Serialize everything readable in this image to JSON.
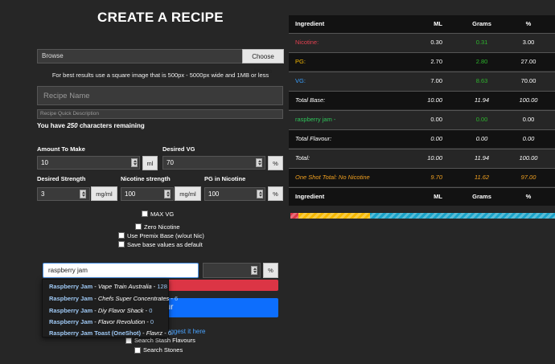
{
  "page": {
    "title": "CREATE A RECIPE"
  },
  "image_upload": {
    "browse_label": "Browse",
    "choose_button": "Choose Image",
    "hint": "For best results use a square image that is 500px - 5000px wide and 1MB or less"
  },
  "recipe": {
    "name_placeholder": "Recipe Name",
    "description_placeholder": "Recipe Quick Description",
    "chars_prefix": "You have",
    "chars_count": "250",
    "chars_suffix": "characters remaining"
  },
  "form": {
    "amount_label": "Amount To Make",
    "amount_value": "10",
    "amount_unit": "ml",
    "desired_vg_label": "Desired VG",
    "desired_vg_value": "70",
    "desired_vg_unit": "%",
    "desired_strength_label": "Desired Strength",
    "desired_strength_value": "3",
    "desired_strength_unit": "mg/ml",
    "nicotine_strength_label": "Nicotine strength",
    "nicotine_strength_value": "100",
    "nicotine_strength_unit": "mg/ml",
    "pg_nicotine_label": "PG in Nicotine",
    "pg_nicotine_value": "100",
    "pg_nicotine_unit": "%"
  },
  "options": {
    "max_vg": "MAX VG",
    "zero_nicotine": "Zero Nicotine",
    "premix": "Use Premix Base (w/out Nic)",
    "save_defaults": "Save base values as default"
  },
  "flavour_search": {
    "value": "raspberry jam",
    "qty_unit": "%",
    "add_button_fragment": "our",
    "suggest_fragment": "uggest it here",
    "search_stash": "Search Stash Flavours",
    "search_stones": "Search Stones",
    "results": [
      {
        "name": "Raspberry Jam",
        "maker": "Vape Train Australia",
        "count": "128"
      },
      {
        "name": "Raspberry Jam",
        "maker": "Chefs Super Concentrates",
        "count": "6"
      },
      {
        "name": "Raspberry Jam",
        "maker": "Diy Flavor Shack",
        "count": "0"
      },
      {
        "name": "Raspberry Jam",
        "maker": "Flavor Revolution",
        "count": "0"
      },
      {
        "name": "Raspberry Jam Toast (OneShot)",
        "maker": "Flavrz",
        "count": "0"
      }
    ]
  },
  "table": {
    "headers": [
      "Ingredient",
      "ML",
      "Grams",
      "%"
    ],
    "rows": [
      {
        "name": "Nicotine:",
        "ml": "0.30",
        "grams": "0.31",
        "pct": "3.00"
      },
      {
        "name": "PG:",
        "ml": "2.70",
        "grams": "2.80",
        "pct": "27.00"
      },
      {
        "name": "VG:",
        "ml": "7.00",
        "grams": "8.63",
        "pct": "70.00"
      },
      {
        "name": "Total Base:",
        "ml": "10.00",
        "grams": "11.94",
        "pct": "100.00"
      },
      {
        "name": "raspberry jam -",
        "ml": "0.00",
        "grams": "0.00",
        "pct": "0.00"
      },
      {
        "name": "Total Flavour:",
        "ml": "0.00",
        "grams": "0.00",
        "pct": "0.00"
      },
      {
        "name": "Total:",
        "ml": "10.00",
        "grams": "11.94",
        "pct": "100.00"
      },
      {
        "name": "One Shot Total: No Nicotine",
        "ml": "9.70",
        "grams": "11.62",
        "pct": "97.00"
      }
    ],
    "footer_headers": [
      "Ingredient",
      "ML",
      "Grams",
      "%"
    ]
  },
  "composition_bar": [
    {
      "label": "Nicotine",
      "percent": 3,
      "color": "#dc3545"
    },
    {
      "label": "PG",
      "percent": 27,
      "color": "#f5b800"
    },
    {
      "label": "VG",
      "percent": 70,
      "color": "#1aa3c8"
    }
  ],
  "colors": {
    "nicotine": "#e04050",
    "pg": "#f5b800",
    "vg": "#38a0ff",
    "grams_green": "#2db52d",
    "one_shot": "#f0a020",
    "flavour": "#2fc45a"
  }
}
